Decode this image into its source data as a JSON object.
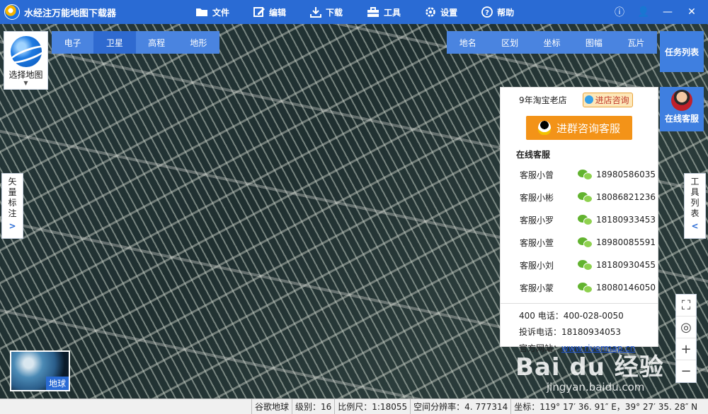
{
  "app": {
    "title": "水经注万能地图下载器"
  },
  "menu": [
    {
      "label": "文件",
      "icon": "folder-icon"
    },
    {
      "label": "编辑",
      "icon": "edit-icon"
    },
    {
      "label": "下载",
      "icon": "download-icon"
    },
    {
      "label": "工具",
      "icon": "toolbox-icon"
    },
    {
      "label": "设置",
      "icon": "gear-icon"
    },
    {
      "label": "帮助",
      "icon": "help-icon"
    }
  ],
  "window_controls": {
    "info": "ⓘ",
    "user": "👤",
    "minimize": "—",
    "close": "✕"
  },
  "map_select": {
    "label": "选择地图"
  },
  "map_type_tabs": [
    {
      "label": "电子"
    },
    {
      "label": "卫星",
      "active": true
    },
    {
      "label": "高程"
    },
    {
      "label": "地形"
    }
  ],
  "overlay_tabs": [
    {
      "label": "地名"
    },
    {
      "label": "区划"
    },
    {
      "label": "坐标"
    },
    {
      "label": "图幅"
    },
    {
      "label": "瓦片"
    }
  ],
  "task_list": {
    "label": "任务列表"
  },
  "online_service": {
    "label": "在线客服"
  },
  "side_left": {
    "chars": [
      "矢",
      "量",
      "标",
      "注"
    ],
    "arrow": ">"
  },
  "side_right": {
    "chars": [
      "工",
      "具",
      "列",
      "表"
    ],
    "arrow": "<"
  },
  "service_panel": {
    "shop": "9年淘宝老店",
    "consult": "进店咨询",
    "qq_button": "进群咨询客服",
    "section_title": "在线客服",
    "agents": [
      {
        "name": "客服小曾",
        "phone": "18980586035"
      },
      {
        "name": "客服小彬",
        "phone": "18086821236"
      },
      {
        "name": "客服小罗",
        "phone": "18180933453"
      },
      {
        "name": "客服小萱",
        "phone": "18980085591"
      },
      {
        "name": "客服小刘",
        "phone": "18180930455"
      },
      {
        "name": "客服小蒙",
        "phone": "18080146050"
      }
    ],
    "phone_400": "400 电话：400-028-0050",
    "complaint": "投诉电话：18180934053",
    "website_label": "官方网站：",
    "website": "www.rivermap.cn"
  },
  "zoom": {
    "fullscreen": "⛶",
    "locate": "◎",
    "zoom_in": "+",
    "zoom_out": "−"
  },
  "earth_thumb": {
    "label": "地球"
  },
  "watermark": {
    "big": "Bai du 经验",
    "small": "jingyan.baidu.com"
  },
  "status": {
    "source": "谷歌地球",
    "level": "级别：16",
    "scale": "比例尺：1:18055",
    "resolution": "空间分辨率：4. 777314",
    "coords": "坐标：119° 17′ 36. 91″ E，39° 27′ 35. 28″ N"
  }
}
